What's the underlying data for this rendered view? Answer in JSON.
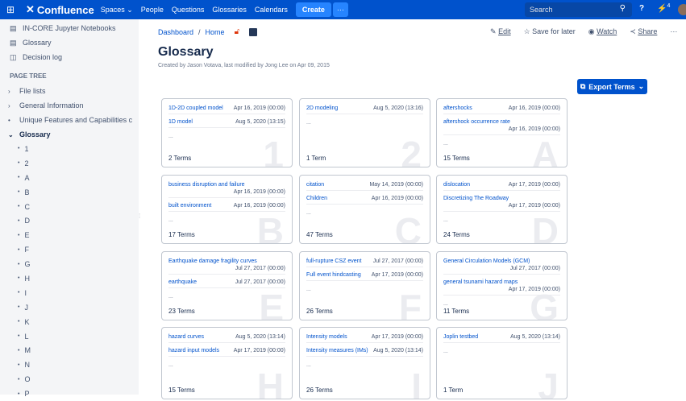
{
  "topbar": {
    "grid_icon": "apps-grid-icon",
    "brand": "Confluence",
    "spaces": "Spaces",
    "people": "People",
    "questions": "Questions",
    "glossaries": "Glossaries",
    "calendars": "Calendars",
    "create": "Create",
    "more": "···",
    "search_placeholder": "Search",
    "notif_count": "4",
    "accent": "#0052cc"
  },
  "sidebar": {
    "links": [
      {
        "label": "IN-CORE Jupyter Notebooks",
        "icon": "page-icon"
      },
      {
        "label": "Glossary",
        "icon": "page-icon"
      },
      {
        "label": "Decision log",
        "icon": "decision-icon"
      }
    ],
    "heading": "PAGE TREE",
    "tree": [
      {
        "label": "File lists",
        "arrow": "›"
      },
      {
        "label": "General Information",
        "arrow": "›"
      },
      {
        "label": "Unique Features and Capabilities c",
        "arrow": "•"
      },
      {
        "label": "Glossary",
        "arrow": "⌄"
      }
    ],
    "children": [
      "1",
      "2",
      "A",
      "B",
      "C",
      "D",
      "E",
      "F",
      "G",
      "H",
      "I",
      "J",
      "K",
      "L",
      "M",
      "N",
      "O",
      "P"
    ]
  },
  "breadcrumb": {
    "dashboard": "Dashboard",
    "sep": "/",
    "home": "Home"
  },
  "actions": {
    "edit": "Edit",
    "save": "Save for later",
    "watch": "Watch",
    "share": "Share",
    "more": "···"
  },
  "page": {
    "title": "Glossary",
    "meta": "Created by Jason Votava, last modified by Jong Lee on Apr 09, 2015",
    "export": "Export Terms"
  },
  "cards": [
    {
      "letter": "1",
      "count": "2 Terms",
      "terms": [
        [
          "1D-2D coupled model",
          "Apr 16, 2019 (00:00)"
        ],
        [
          "1D model",
          "Aug 5, 2020 (13:15)"
        ]
      ],
      "more": "..."
    },
    {
      "letter": "2",
      "count": "1 Term",
      "terms": [
        [
          "2D modeling",
          "Aug 5, 2020 (13:16)"
        ]
      ],
      "more": "..."
    },
    {
      "letter": "A",
      "count": "15 Terms",
      "terms": [
        [
          "aftershocks",
          "Apr 16, 2019 (00:00)"
        ],
        [
          "aftershock occurrence rate",
          "Apr 16, 2019 (00:00)"
        ]
      ],
      "more": "..."
    },
    {
      "letter": "B",
      "count": "17 Terms",
      "terms": [
        [
          "business disruption and failure",
          "Apr 16, 2019 (00:00)"
        ],
        [
          "built environment",
          "Apr 16, 2019 (00:00)"
        ]
      ],
      "more": "..."
    },
    {
      "letter": "C",
      "count": "47 Terms",
      "terms": [
        [
          "citation",
          "May 14, 2019 (00:00)"
        ],
        [
          "Children",
          "Apr 16, 2019 (00:00)"
        ]
      ],
      "more": "..."
    },
    {
      "letter": "D",
      "count": "24 Terms",
      "terms": [
        [
          "dislocation",
          "Apr 17, 2019 (00:00)"
        ],
        [
          "Discretizing The Roadway",
          "Apr 17, 2019 (00:00)"
        ]
      ],
      "more": "..."
    },
    {
      "letter": "E",
      "count": "23 Terms",
      "terms": [
        [
          "Earthquake damage fragility curves",
          "Jul 27, 2017 (00:00)"
        ],
        [
          "earthquake",
          "Jul 27, 2017 (00:00)"
        ]
      ],
      "more": "..."
    },
    {
      "letter": "F",
      "count": "26 Terms",
      "terms": [
        [
          "full-rupture CSZ event",
          "Jul 27, 2017 (00:00)"
        ],
        [
          "Full event hindcasting",
          "Apr 17, 2019 (00:00)"
        ]
      ],
      "more": "..."
    },
    {
      "letter": "G",
      "count": "11 Terms",
      "terms": [
        [
          "General Circulation Models (GCM)",
          "Jul 27, 2017 (00:00)"
        ],
        [
          "general tsunami hazard maps",
          "Apr 17, 2019 (00:00)"
        ]
      ],
      "more": "..."
    },
    {
      "letter": "H",
      "count": "15 Terms",
      "terms": [
        [
          "hazard curves",
          "Aug 5, 2020 (13:14)"
        ],
        [
          "hazard input models",
          "Apr 17, 2019 (00:00)"
        ]
      ],
      "more": "..."
    },
    {
      "letter": "I",
      "count": "26 Terms",
      "terms": [
        [
          "Intensity models",
          "Apr 17, 2019 (00:00)"
        ],
        [
          "Intensity measures (IMs)",
          "Aug 5, 2020 (13:14)"
        ]
      ],
      "more": "..."
    },
    {
      "letter": "J",
      "count": "1 Term",
      "terms": [
        [
          "Joplin testbed",
          "Aug 5, 2020 (13:14)"
        ]
      ],
      "more": "..."
    }
  ]
}
